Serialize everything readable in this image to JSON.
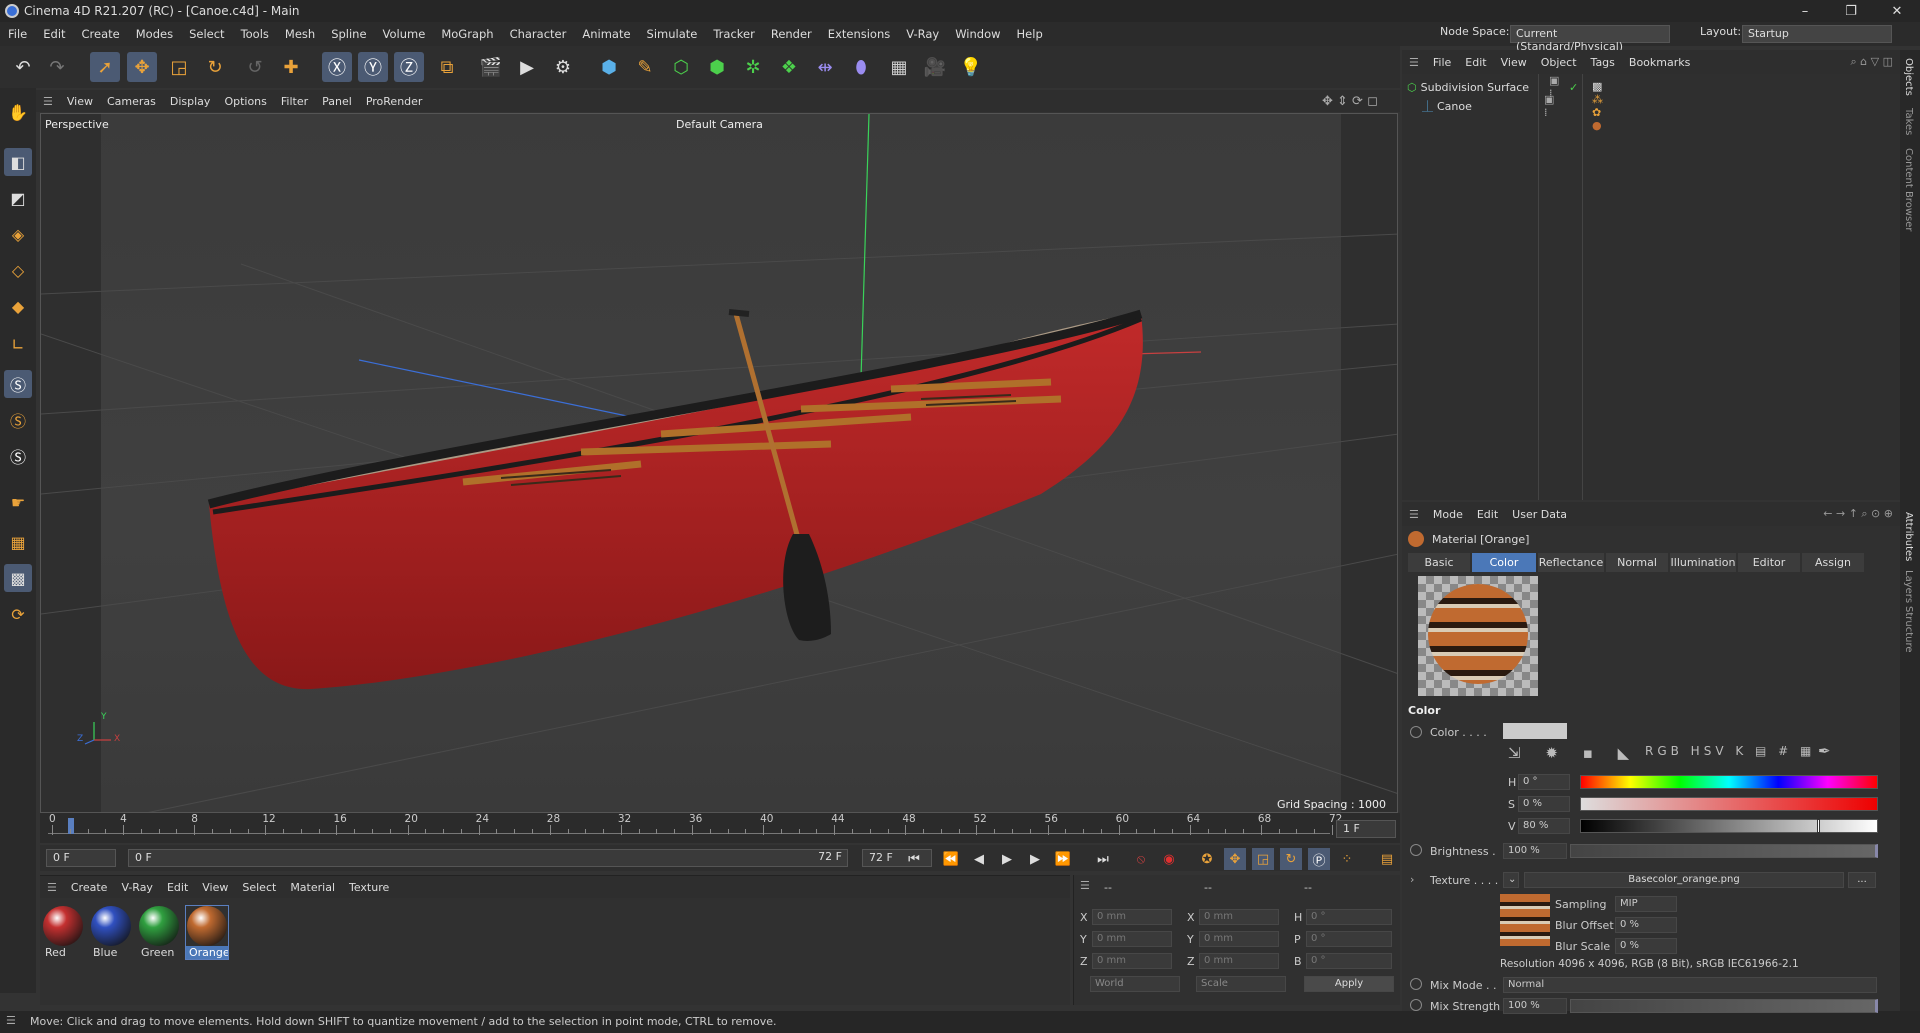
{
  "window": {
    "title": "Cinema 4D R21.207 (RC) - [Canoe.c4d] - Main",
    "min": "–",
    "max": "❐",
    "close": "✕"
  },
  "menubar": [
    "File",
    "Edit",
    "Create",
    "Modes",
    "Select",
    "Tools",
    "Mesh",
    "Spline",
    "Volume",
    "MoGraph",
    "Character",
    "Animate",
    "Simulate",
    "Tracker",
    "Render",
    "Extensions",
    "V-Ray",
    "Window",
    "Help"
  ],
  "nodespace": {
    "label": "Node Space:",
    "value": "Current (Standard/Physical)",
    "layout_label": "Layout:",
    "layout_value": "Startup"
  },
  "viewport_menu": [
    "View",
    "Cameras",
    "Display",
    "Options",
    "Filter",
    "Panel",
    "ProRender"
  ],
  "viewport": {
    "name": "Perspective",
    "camera": "Default Camera",
    "grid": "Grid Spacing : 1000 mm",
    "axis_x": "X",
    "axis_y": "Y",
    "axis_z": "Z"
  },
  "timeline": {
    "ticks": [
      "0",
      "4",
      "8",
      "12",
      "16",
      "20",
      "24",
      "28",
      "32",
      "36",
      "40",
      "44",
      "48",
      "52",
      "56",
      "60",
      "64",
      "68",
      "72"
    ],
    "current": "1 F",
    "start": "0 F",
    "start2": "0 F",
    "end": "72 F",
    "end2": "72 F"
  },
  "matmgr": {
    "menu": [
      "Create",
      "V-Ray",
      "Edit",
      "View",
      "Select",
      "Material",
      "Texture"
    ],
    "materials": [
      {
        "name": "Red",
        "color": "#c43030"
      },
      {
        "name": "Blue",
        "color": "#3050c0"
      },
      {
        "name": "Green",
        "color": "#30a040"
      },
      {
        "name": "Orange",
        "color": "#c06a30"
      }
    ]
  },
  "coords": {
    "header1": "--",
    "header2": "--",
    "header3": "--",
    "x": "X",
    "y": "Y",
    "z": "Z",
    "sx": "X",
    "sy": "Y",
    "sz": "Z",
    "h": "H",
    "p": "P",
    "b": "B",
    "val_mm": "0 mm",
    "val_deg": "0 °",
    "world": "World",
    "scale": "Scale",
    "apply": "Apply"
  },
  "status": "Move: Click and drag to move elements. Hold down SHIFT to quantize movement / add to the selection in point mode, CTRL to remove.",
  "objmgr": {
    "menu": [
      "File",
      "Edit",
      "View",
      "Object",
      "Tags",
      "Bookmarks"
    ],
    "objects": [
      {
        "name": "Subdivision Surface"
      },
      {
        "name": "Canoe"
      }
    ]
  },
  "attr": {
    "menu": [
      "Mode",
      "Edit",
      "User Data"
    ],
    "title": "Material [Orange]",
    "tabs": [
      "Basic",
      "Color",
      "Reflectance",
      "Normal",
      "Illumination",
      "Editor",
      "Assign"
    ],
    "section": "Color",
    "color_label": "Color . . . .",
    "h_label": "H",
    "h_val": "0 °",
    "s_label": "S",
    "s_val": "0 %",
    "v_label": "V",
    "v_val": "80 %",
    "brightness_label": "Brightness .",
    "brightness_val": "100 %",
    "texture_label": "Texture . . . .",
    "texture_file": "Basecolor_orange.png",
    "texture_btn": "...",
    "sampling_label": "Sampling",
    "sampling_val": "MIP",
    "bluroff_label": "Blur Offset",
    "bluroff_val": "0 %",
    "blurscale_label": "Blur Scale",
    "blurscale_val": "0 %",
    "resolution": "Resolution 4096 x 4096, RGB (8 Bit), sRGB IEC61966-2.1",
    "mixmode_label": "Mix Mode . .",
    "mixmode_val": "Normal",
    "mixstrength_label": "Mix Strength",
    "mixstrength_val": "100 %"
  },
  "rightstrip": [
    "Objects",
    "Takes",
    "Content Browser",
    "Attributes",
    "Layers",
    "Structure"
  ]
}
